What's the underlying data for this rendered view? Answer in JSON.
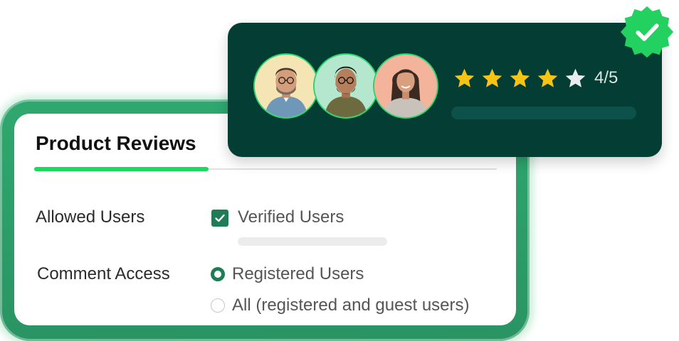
{
  "settings": {
    "title": "Product Reviews",
    "allowed_users": {
      "label": "Allowed Users",
      "option": "Verified Users",
      "checked": true
    },
    "comment_access": {
      "label": "Comment Access",
      "options": [
        {
          "label": "Registered Users",
          "selected": true
        },
        {
          "label": "All (registered and guest users)",
          "selected": false
        }
      ]
    }
  },
  "review": {
    "avatars": [
      {
        "icon": "man-with-glasses-avatar",
        "bg": "#f6e5b4"
      },
      {
        "icon": "bearded-man-avatar",
        "bg": "#b5e7cf"
      },
      {
        "icon": "smiling-woman-avatar",
        "bg": "#f4b49c"
      }
    ],
    "rating": 4,
    "rating_max": 5,
    "rating_text": "4/5",
    "verified_icon": "verified-check-badge-icon"
  },
  "colors": {
    "brand_green": "#1ed760",
    "dark_teal": "#033d33",
    "frame_green": "#2a9463",
    "star_gold": "#f6c414",
    "star_empty": "#e9ecee",
    "checkbox_green": "#1e7d56"
  }
}
